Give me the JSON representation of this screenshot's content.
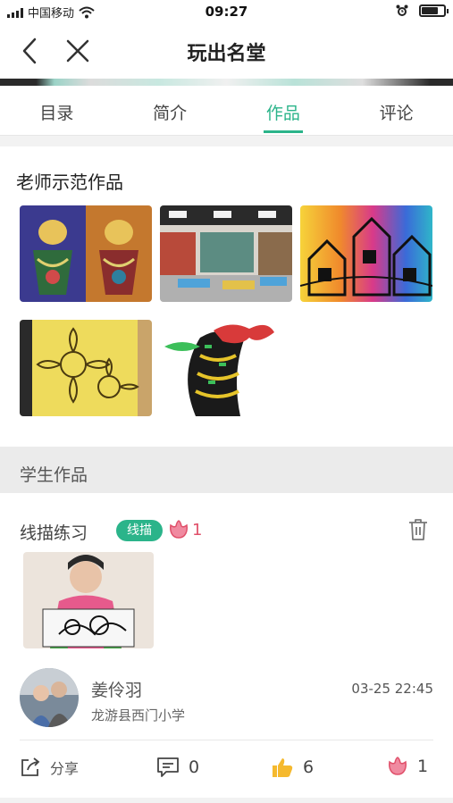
{
  "status_bar": {
    "carrier": "中国移动",
    "time": "09:27"
  },
  "nav": {
    "title": "玩出名堂",
    "back_icon": "back-arrow-icon",
    "close_icon": "close-icon"
  },
  "tabs": [
    {
      "label": "目录",
      "active": false
    },
    {
      "label": "简介",
      "active": false
    },
    {
      "label": "作品",
      "active": true
    },
    {
      "label": "评论",
      "active": false
    }
  ],
  "teacher_section": {
    "title": "老师示范作品",
    "works": [
      {
        "name": "门神线描彩绘"
      },
      {
        "name": "美术教室"
      },
      {
        "name": "彩色城堡线描"
      },
      {
        "name": "向日葵线描"
      },
      {
        "name": "公鸡线描"
      }
    ]
  },
  "student_section": {
    "title": "学生作品",
    "post": {
      "title": "线描练习",
      "tag": "线描",
      "flower_count": "1",
      "author": "姜伶羽",
      "school": "龙游县西门小学",
      "time": "03-25 22:45",
      "actions": {
        "share_label": "分享",
        "comment_count": "0",
        "like_count": "6",
        "flower_count": "1"
      }
    }
  },
  "colors": {
    "accent": "#2bb48a",
    "flower": "#e0506a",
    "like": "#f5b92e"
  }
}
